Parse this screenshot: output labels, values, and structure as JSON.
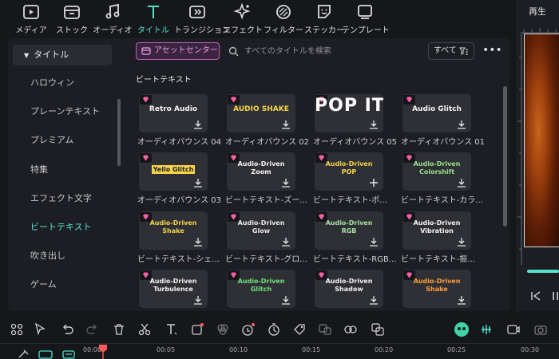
{
  "topbar": {
    "tools": [
      {
        "label": "メディア",
        "icon": "media-icon"
      },
      {
        "label": "ストック",
        "icon": "stock-icon"
      },
      {
        "label": "オーディオ",
        "icon": "music-note-icon"
      },
      {
        "label": "タイトル",
        "icon": "title-t-icon"
      },
      {
        "label": "トランジション",
        "icon": "transition-icon"
      },
      {
        "label": "エフェクト",
        "icon": "effect-sparkle-icon"
      },
      {
        "label": "フィルター",
        "icon": "filter-icon"
      },
      {
        "label": "ステッカー",
        "icon": "sticker-icon"
      },
      {
        "label": "テンプレート",
        "icon": "template-icon"
      }
    ],
    "active": "タイトル"
  },
  "preview": {
    "tab_label": "再生"
  },
  "sidebar": {
    "header": "タイトル",
    "items": [
      "ハロウィン",
      "プレーンテキスト",
      "プレミアム",
      "特集",
      "エフェクト文字",
      "ビートテキスト",
      "吹き出し",
      "ゲーム"
    ],
    "selected": "ビートテキスト"
  },
  "library": {
    "asset_center_label": "アセットセンター",
    "search_placeholder": "すべてのタイトルを検索",
    "filter_label": "すべて",
    "more_label": "•••",
    "section_title": "ビートテキスト",
    "cards": [
      {
        "preview": "Retro Audio",
        "label": "オーディオバウンス 04",
        "color": "#f2f2f2",
        "action": "download"
      },
      {
        "preview": "AUDIO SHAKE",
        "label": "オーディオバウンス 02",
        "color": "#f4d34a",
        "action": "download"
      },
      {
        "preview": "POP IT",
        "label": "オーディオバウンス 05",
        "color": "#ffffff",
        "action": "download"
      },
      {
        "preview": "Audio Glitch",
        "label": "オーディオバウンス 01",
        "color": "#f2f2f2",
        "action": "download"
      },
      {
        "preview": "Yello Glitch",
        "label": "オーディオバウンス 03",
        "color": "#222222",
        "action": "download"
      },
      {
        "preview": "Audio-Driven Zoom",
        "label": "ビートテキスト-ズー...",
        "color": "#f2f2f2",
        "action": "download"
      },
      {
        "preview": "Audio-Driven POP",
        "label": "ビートテキスト-ポ...",
        "color": "#f4d34a",
        "action": "add"
      },
      {
        "preview": "Audio-Driven Colorshift",
        "label": "ビートテキスト-カラ...",
        "color": "#9be08a",
        "action": "download"
      },
      {
        "preview": "Audio-Driven Shake",
        "label": "ビートテキスト-シェ...",
        "color": "#f4d34a",
        "action": "download"
      },
      {
        "preview": "Audio-Driven Glow",
        "label": "ビートテキスト-グロ...",
        "color": "#e8e8e8",
        "action": "download"
      },
      {
        "preview": "Audio-Driven RGB",
        "label": "ビートテキスト-RGB...",
        "color": "#a8e0a0",
        "action": "download"
      },
      {
        "preview": "Audio-Driven Vibration",
        "label": "ビートテキスト-振...",
        "color": "#f2f2f2",
        "action": "download"
      },
      {
        "preview": "Audio-Driven Turbulence",
        "label": "",
        "color": "#f2f2f2",
        "action": "download"
      },
      {
        "preview": "Audio-Driven Glitch",
        "label": "",
        "color": "#6fe07a",
        "action": "download"
      },
      {
        "preview": "Audio-Driven Shadow",
        "label": "",
        "color": "#f2f2f2",
        "action": "download"
      },
      {
        "preview": "Audio-Driven Shake",
        "label": "",
        "color": "#ff9c3a",
        "action": "download"
      }
    ]
  },
  "timeline": {
    "ticks": [
      "00:00",
      "00:05",
      "00:10",
      "00:15",
      "00:20",
      "00:25",
      "00:30"
    ]
  },
  "colors": {
    "accent": "#4fe3d0",
    "asset_pink": "#ef9fe9",
    "premium_gem": "#ff5fa8"
  }
}
